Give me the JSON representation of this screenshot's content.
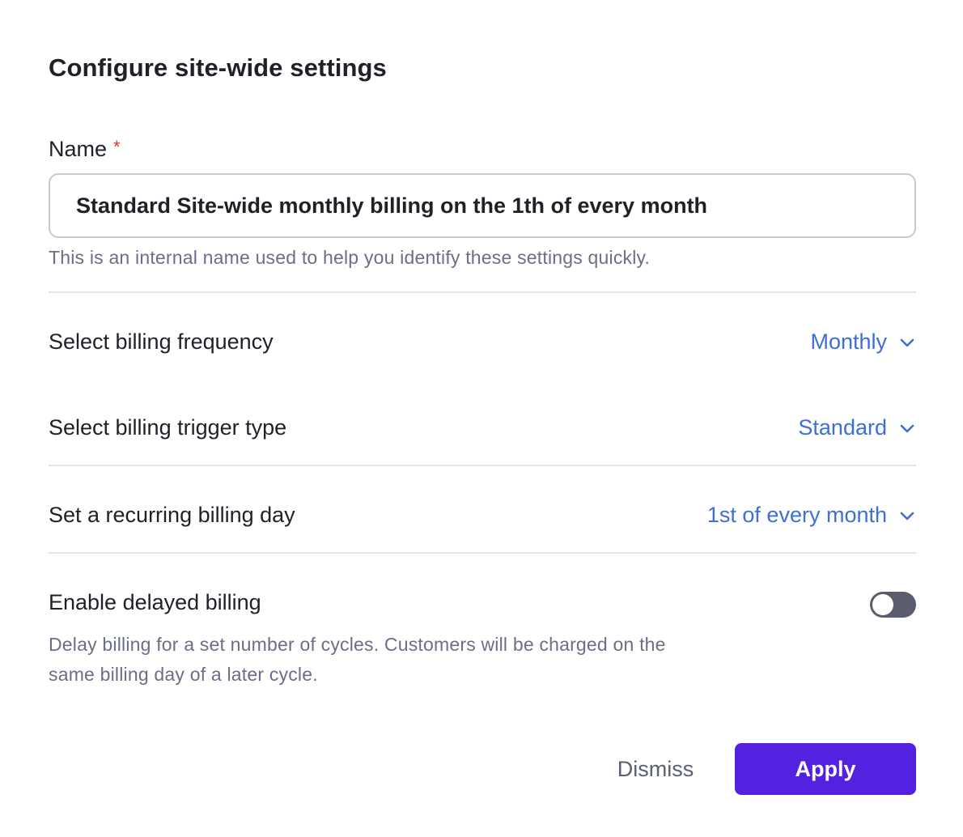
{
  "dialog": {
    "title": "Configure site-wide settings"
  },
  "name_field": {
    "label": "Name",
    "required_marker": "*",
    "value": "Standard Site-wide monthly billing on the 1th of every month",
    "helper": "This is an internal name used to help you identify these settings quickly."
  },
  "settings": {
    "frequency": {
      "label": "Select billing frequency",
      "value": "Monthly",
      "icon": "chevron-down-icon"
    },
    "trigger": {
      "label": "Select billing trigger type",
      "value": "Standard",
      "icon": "chevron-down-icon"
    },
    "billing_day": {
      "label": "Set a recurring billing day",
      "value": "1st of every month",
      "icon": "chevron-down-icon"
    }
  },
  "delayed_billing": {
    "label": "Enable delayed billing",
    "enabled": false,
    "description": "Delay billing for a set number of cycles. Customers will be charged on the same billing day of a later cycle."
  },
  "actions": {
    "dismiss_label": "Dismiss",
    "apply_label": "Apply"
  },
  "colors": {
    "accent": "#5521e0",
    "link": "#3d6fd6",
    "required": "#d33a2c",
    "toggle_off": "#5b5d6e"
  }
}
